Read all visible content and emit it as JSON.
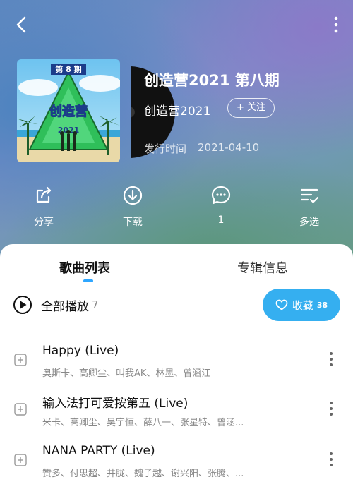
{
  "album": {
    "title": "创造营2021 第八期",
    "artist": "创造营2021",
    "follow_label": "+ 关注",
    "release_label": "发行时间",
    "release_date": "2021-04-10",
    "cover_text": {
      "issue": "第 8 期",
      "logo": "创造营",
      "year": "2021"
    }
  },
  "actions": [
    {
      "label": "分享",
      "icon": "share-icon"
    },
    {
      "label": "下载",
      "icon": "download-icon"
    },
    {
      "label": "1",
      "icon": "comment-icon"
    },
    {
      "label": "多选",
      "icon": "multi-select-icon"
    }
  ],
  "tabs": {
    "songs": "歌曲列表",
    "info": "专辑信息"
  },
  "play_all": {
    "label": "全部播放",
    "count": "7"
  },
  "collect": {
    "label": "收藏",
    "count": "38"
  },
  "songs": [
    {
      "title": "Happy (Live)",
      "artists": "奥斯卡、高卿尘、叫我AK、林墨、曾涵江"
    },
    {
      "title": "输入法打可爱按第五 (Live)",
      "artists": "米卡、高卿尘、吴宇恒、薛八一、张星特、曾涵..."
    },
    {
      "title": "NANA PARTY (Live)",
      "artists": "赞多、付思超、井胧、魏子越、谢兴阳、张腾、..."
    }
  ],
  "colors": {
    "accent": "#35aff0",
    "indicator": "#2ea6ff"
  }
}
